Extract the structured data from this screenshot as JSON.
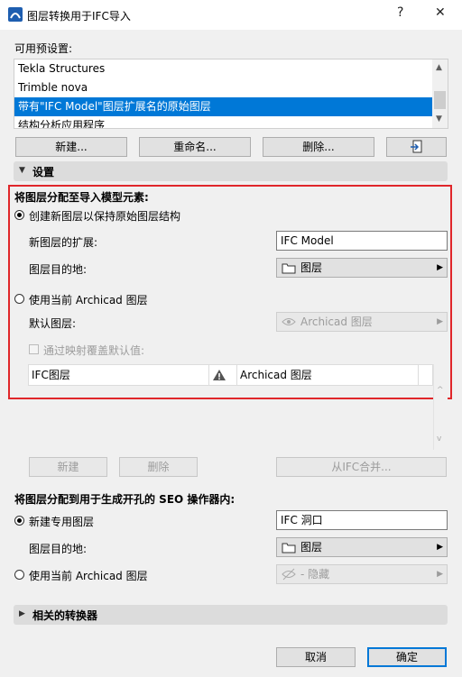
{
  "window": {
    "title": "图层转换用于IFC导入",
    "help_btn": "?",
    "close_btn": "✕"
  },
  "presets": {
    "label": "可用预设置:",
    "items": [
      "Tekla Structures",
      "Trimble nova",
      "带有\"IFC Model\"图层扩展名的原始图层",
      "结构分析应用程序"
    ],
    "selected_index": 2,
    "buttons": {
      "new": "新建...",
      "rename": "重命名...",
      "delete": "删除..."
    }
  },
  "settings": {
    "header": "设置",
    "assign_title": "将图层分配至导入模型元素:",
    "option_create": "创建新图层以保持原始图层结构",
    "ext_label": "新图层的扩展:",
    "ext_value": "IFC Model",
    "dest_label": "图层目的地:",
    "dest_value": "图层",
    "option_use_current": "使用当前 Archicad 图层",
    "default_label": "默认图层:",
    "default_value": "Archicad 图层",
    "override_label": "通过映射覆盖默认值:",
    "grid_col1": "IFC图层",
    "grid_col3": "Archicad 图层",
    "btn_new": "新建",
    "btn_delete": "删除",
    "btn_merge": "从IFC合并..."
  },
  "seo": {
    "title": "将图层分配到用于生成开孔的 SEO 操作器内:",
    "option_new": "新建专用图层",
    "new_value": "IFC 洞口",
    "dest_label": "图层目的地:",
    "dest_value": "图层",
    "option_current": "使用当前 Archicad 图层",
    "current_value": "- 隐藏"
  },
  "related": {
    "header": "相关的转换器"
  },
  "footer": {
    "cancel": "取消",
    "ok": "确定"
  },
  "colors": {
    "accent": "#0078d7",
    "highlight_box": "#e0262a"
  }
}
